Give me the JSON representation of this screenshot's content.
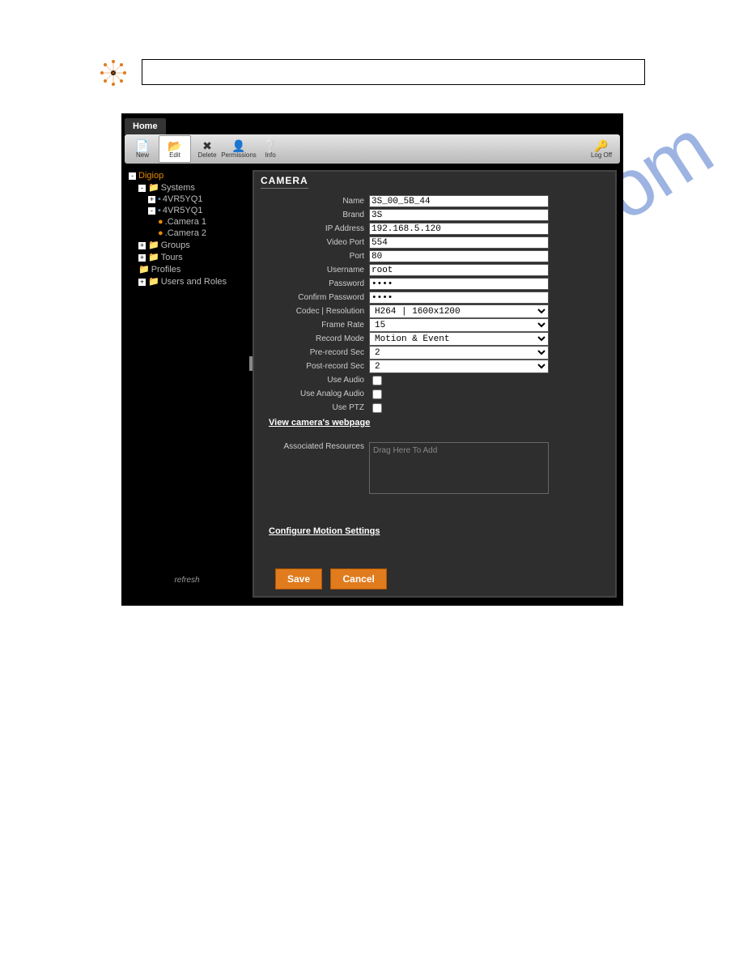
{
  "tabs": {
    "home": "Home"
  },
  "toolbar": {
    "new": "New",
    "edit": "Edit",
    "delete": "Delete",
    "permissions": "Permissions",
    "info": "Info",
    "logoff": "Log Off"
  },
  "tree": {
    "root": "Digiop",
    "systems": "Systems",
    "sys1": "4VR5YQ1",
    "sys2": "4VR5YQ1",
    "cam1": ".Camera 1",
    "cam2": ".Camera 2",
    "groups": "Groups",
    "tours": "Tours",
    "profiles": "Profiles",
    "users": "Users and Roles",
    "refresh": "refresh"
  },
  "panel": {
    "title": "CAMERA",
    "labels": {
      "name": "Name",
      "brand": "Brand",
      "ip": "IP Address",
      "vport": "Video Port",
      "port": "Port",
      "user": "Username",
      "pass": "Password",
      "cpass": "Confirm Password",
      "codec": "Codec | Resolution",
      "frate": "Frame Rate",
      "rmode": "Record Mode",
      "pre": "Pre-record Sec",
      "post": "Post-record Sec",
      "audio": "Use Audio",
      "aaudio": "Use Analog Audio",
      "ptz": "Use PTZ",
      "res": "Associated Resources"
    },
    "values": {
      "name": "3S_00_5B_44",
      "brand": "3S",
      "ip": "192.168.5.120",
      "vport": "554",
      "port": "80",
      "user": "root",
      "pass": "••••",
      "cpass": "••••",
      "codec": "H264 | 1600x1200",
      "frate": "15",
      "rmode": "Motion & Event",
      "pre": "2",
      "post": "2"
    },
    "links": {
      "webpage": "View camera's webpage",
      "motion": "Configure Motion Settings"
    },
    "drop": "Drag Here To Add",
    "save": "Save",
    "cancel": "Cancel"
  },
  "watermark": "manualshive.com"
}
